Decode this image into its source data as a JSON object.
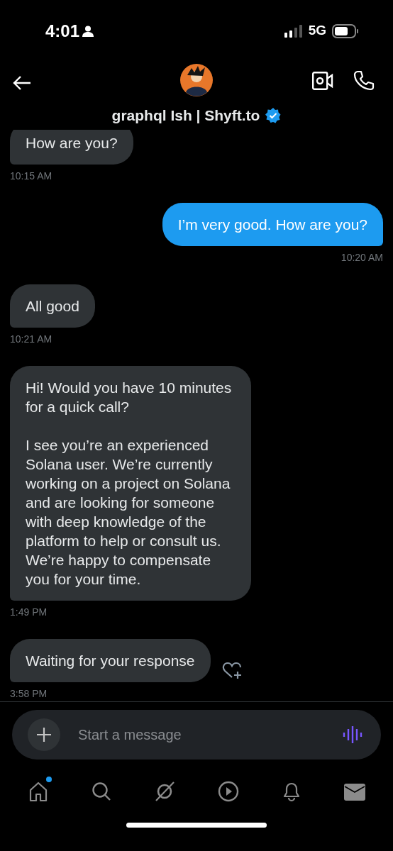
{
  "status_bar": {
    "time": "4:01",
    "network": "5G"
  },
  "header": {
    "name": "graphql Ish | Shyft.to",
    "verified": true
  },
  "messages": [
    {
      "kind": "received",
      "text": "How are you?",
      "time": "10:15 AM"
    },
    {
      "kind": "sent",
      "text": "I’m very good. How are you?",
      "time": "10:20 AM"
    },
    {
      "kind": "received",
      "text": "All good",
      "time": "10:21 AM"
    },
    {
      "kind": "received",
      "text": "Hi! Would you have 10 minutes for a quick call?\n\nI see you’re an experienced Solana user. We’re currently working on a project on Solana and are looking for someone with deep knowledge of the platform to help or consult us. We’re happy to compensate you for your time.",
      "time": "1:49 PM"
    },
    {
      "kind": "received",
      "text": "Waiting for your response",
      "time": "3:58 PM",
      "react_button": true
    }
  ],
  "composer": {
    "placeholder": "Start a message"
  },
  "nav": [
    {
      "selected": false,
      "dot": true
    },
    {
      "selected": false
    },
    {
      "selected": false
    },
    {
      "selected": false
    },
    {
      "selected": false
    },
    {
      "selected": true
    }
  ]
}
